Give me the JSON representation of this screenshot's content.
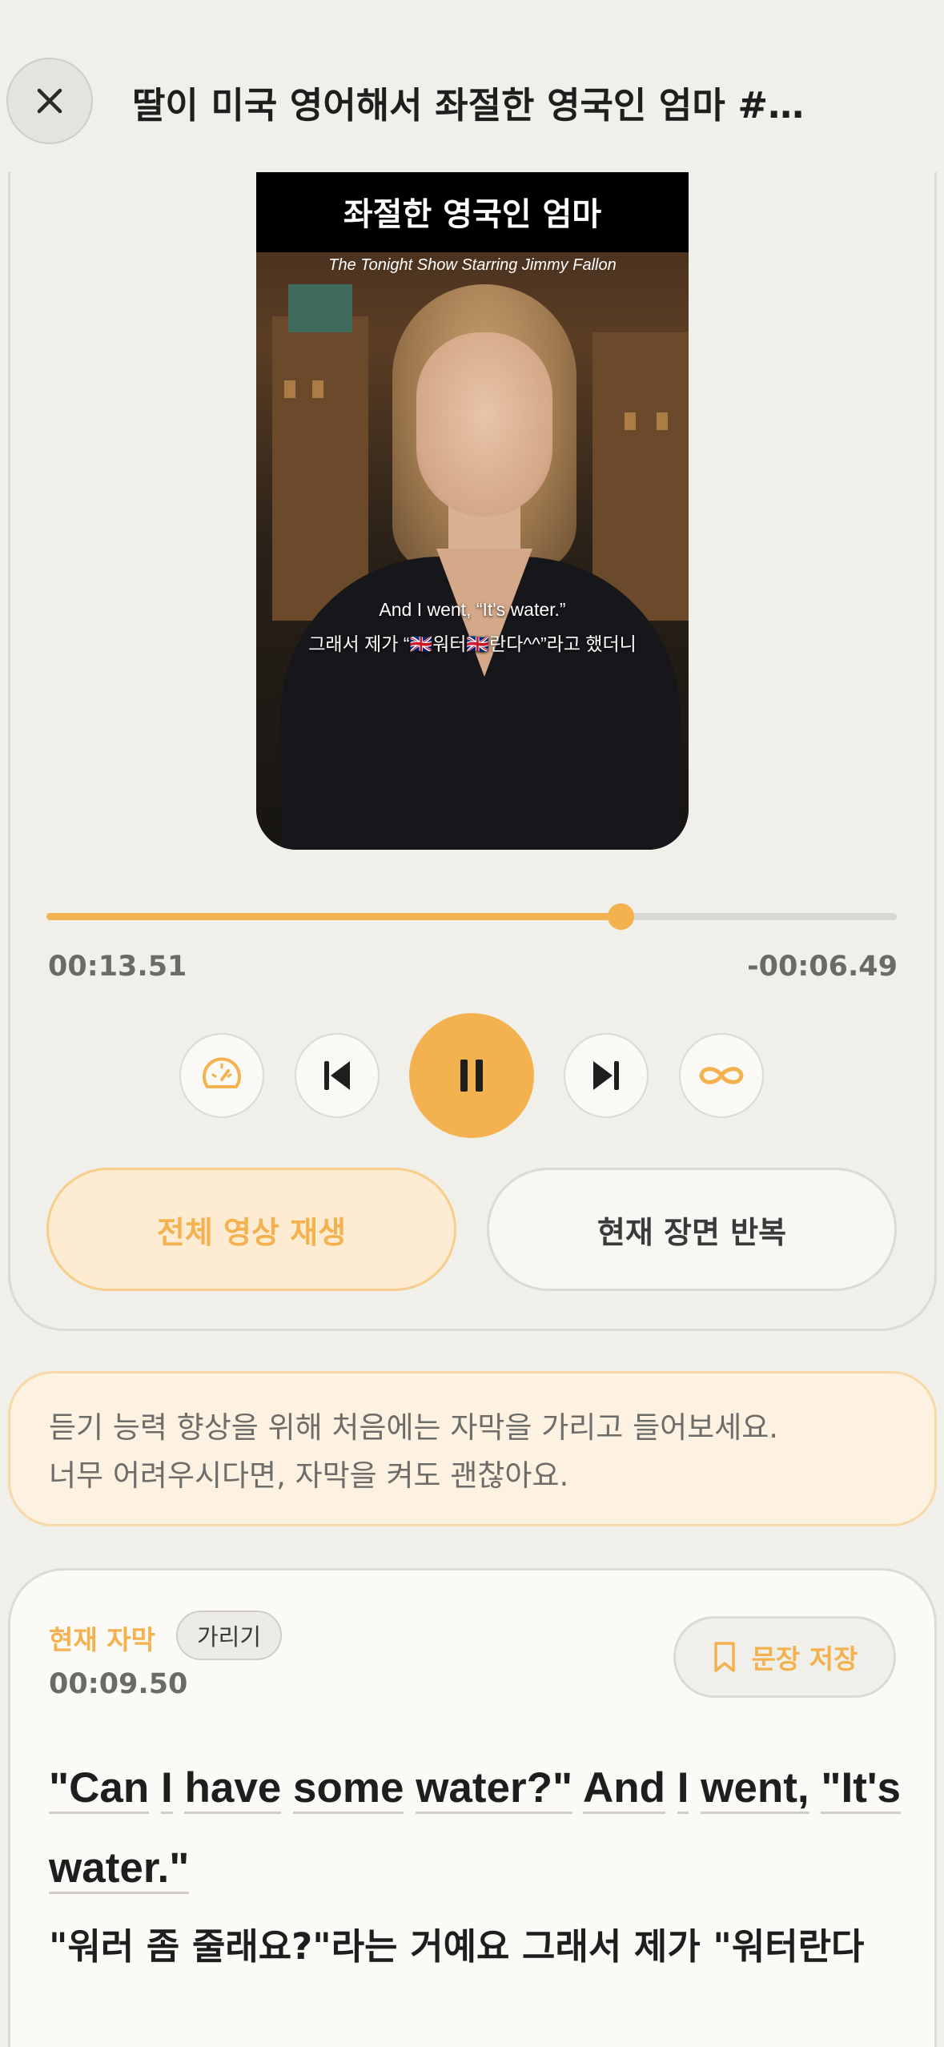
{
  "header": {
    "title": "딸이 미국 영어해서 좌절한 영국인 엄마 #영…"
  },
  "video": {
    "headline_line2": "좌절한 영국인 엄마",
    "credit": "The Tonight Show Starring Jimmy Fallon",
    "caption_en": "And I went, “It's water.”",
    "caption_ko": "그래서 제가 “🇬🇧워터🇬🇧란다^^”라고 했더니"
  },
  "playback": {
    "current_time": "00:13.51",
    "remaining_time": "-00:06.49",
    "progress_fraction": 0.675
  },
  "controls": {
    "full_play_label": "전체 영상 재생",
    "repeat_label": "현재 장면 반복"
  },
  "tip": {
    "line1": "듣기 능력 향상을 위해 처음에는 자막을 가리고 들어보세요.",
    "line2": "너무 어려우시다면, 자막을 켜도 괜찮아요."
  },
  "subtitle": {
    "label": "현재 자막",
    "hide_label": "가리기",
    "time": "00:09.50",
    "save_label": "문장 저장",
    "sentence_words": [
      "\"Can",
      "I",
      "have",
      "some",
      "water?\"",
      "And",
      "I",
      "went,",
      "\"It's",
      "water.\""
    ],
    "translation": "\"워러 좀 줄래요?\"라는 거예요 그래서 제가 \"워터란다"
  },
  "colors": {
    "accent": "#f3b24f",
    "accent_light": "#fdecd2",
    "background": "#f0efea"
  }
}
